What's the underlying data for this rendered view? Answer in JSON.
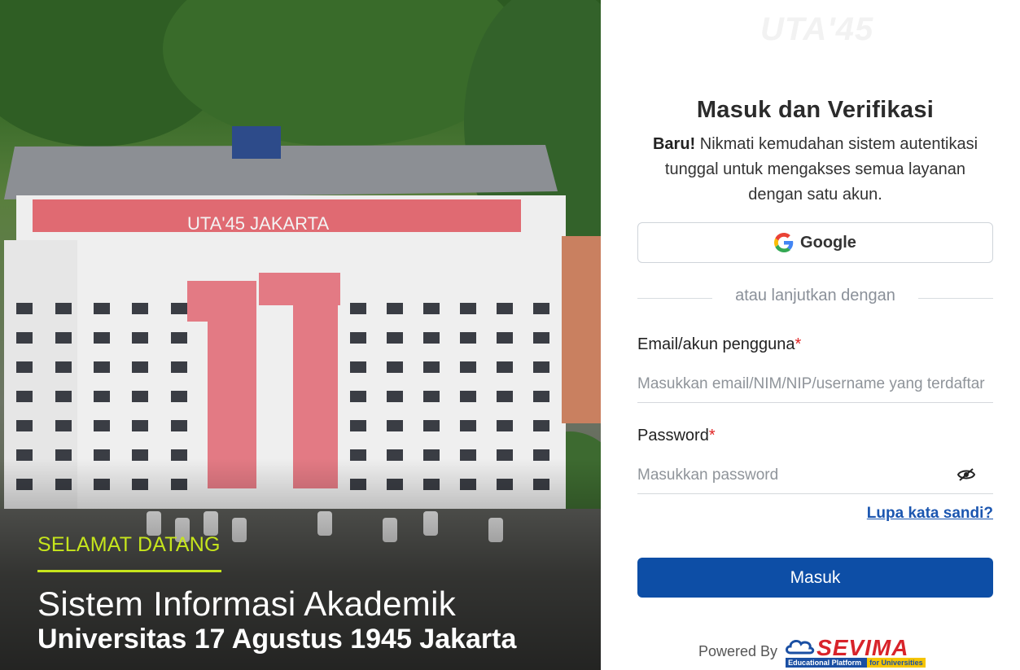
{
  "hero": {
    "welcome": "SELAMAT DATANG",
    "title": "Sistem Informasi Akademik",
    "subtitle": "Universitas 17 Agustus 1945 Jakarta",
    "building_sign": "UTA'45 JAKARTA",
    "building_number": "17",
    "accent_color": "#c6e51c"
  },
  "logo": {
    "text": "UTA'45"
  },
  "login": {
    "title": "Masuk dan Verifikasi",
    "desc_bold": "Baru!",
    "desc_rest": " Nikmati kemudahan sistem autentikasi tunggal untuk mengakses semua layanan dengan satu akun.",
    "google_label": "Google",
    "divider_text": "atau lanjutkan dengan",
    "email_label": "Email/akun pengguna",
    "email_placeholder": "Masukkan email/NIM/NIP/username yang terdaftar",
    "password_label": "Password",
    "password_placeholder": "Masukkan password",
    "required_mark": "*",
    "forgot_label": "Lupa kata sandi?",
    "submit_label": "Masuk",
    "primary_color": "#0d4ea6"
  },
  "footer": {
    "powered_by": "Powered By",
    "brand": "SEVIMA",
    "brand_tag_left": "Educational Platform",
    "brand_tag_right": "for Universities"
  }
}
